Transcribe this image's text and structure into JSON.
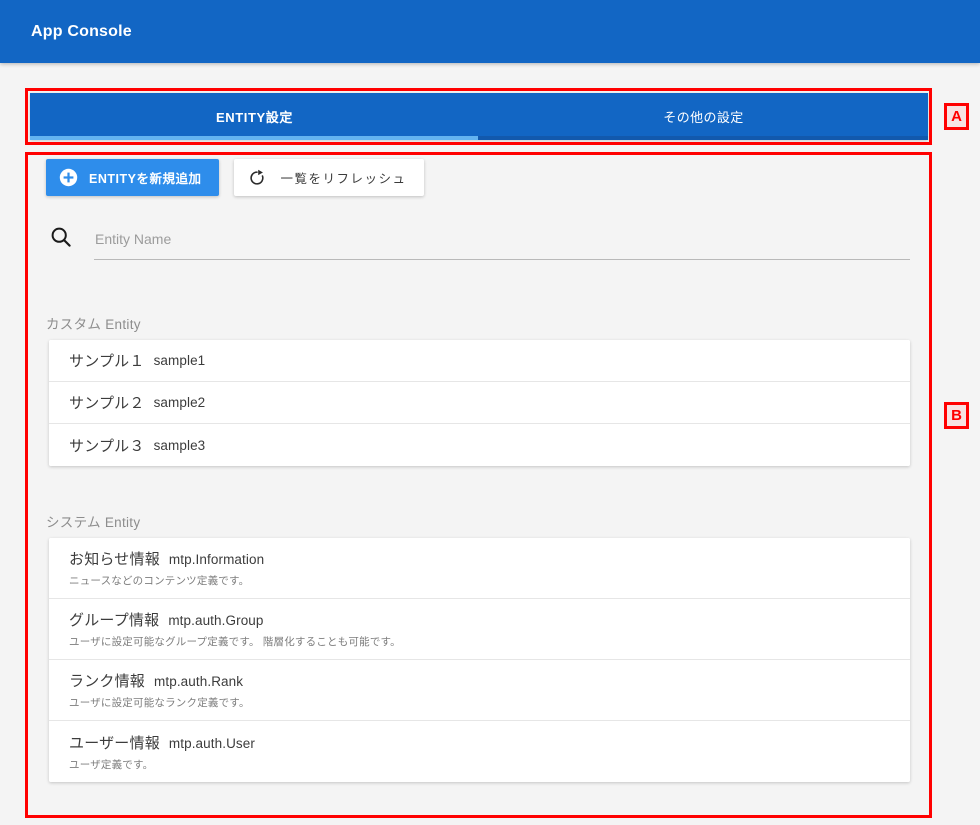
{
  "appbar": {
    "title": "App Console"
  },
  "tabs": [
    {
      "label": "ENTITY設定",
      "active": true
    },
    {
      "label": "その他の設定",
      "active": false
    }
  ],
  "toolbar": {
    "add_label": "ENTITYを新規追加",
    "add_icon": "plus-circle-icon",
    "add_color": "#2e8deb",
    "refresh_label": "一覧をリフレッシュ",
    "refresh_icon": "refresh-icon"
  },
  "search": {
    "icon": "search-icon",
    "placeholder": "Entity Name",
    "value": ""
  },
  "sections": {
    "custom": {
      "label": "カスタム Entity",
      "rows": [
        {
          "title": "サンプル１",
          "key": "sample1"
        },
        {
          "title": "サンプル２",
          "key": "sample2"
        },
        {
          "title": "サンプル３",
          "key": "sample3"
        }
      ]
    },
    "system": {
      "label": "システム Entity",
      "rows": [
        {
          "title": "お知らせ情報",
          "key": "mtp.Information",
          "desc": "ニュースなどのコンテンツ定義です。"
        },
        {
          "title": "グループ情報",
          "key": "mtp.auth.Group",
          "desc": "ユーザに設定可能なグループ定義です。 階層化することも可能です。"
        },
        {
          "title": "ランク情報",
          "key": "mtp.auth.Rank",
          "desc": "ユーザに設定可能なランク定義です。"
        },
        {
          "title": "ユーザー情報",
          "key": "mtp.auth.User",
          "desc": "ユーザ定義です。"
        }
      ]
    }
  },
  "annotations": {
    "a": "A",
    "b": "B",
    "color": "#ff0000"
  }
}
